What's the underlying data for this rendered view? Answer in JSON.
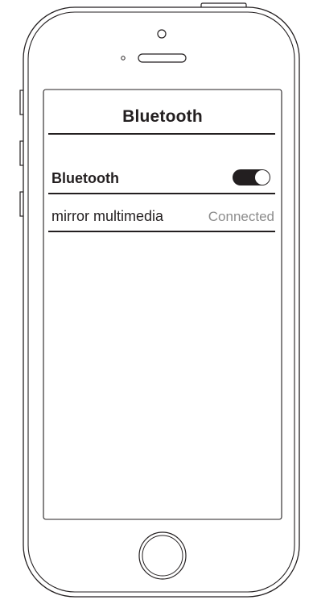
{
  "nav": {
    "title": "Bluetooth"
  },
  "settings": {
    "bluetooth_row": {
      "label": "Bluetooth",
      "toggle_state": "on"
    },
    "device_row": {
      "label": "mirror multimedia",
      "status": "Connected"
    }
  },
  "colors": {
    "ink": "#231f20",
    "status_gray": "#8c8c8c",
    "background": "#ffffff"
  }
}
